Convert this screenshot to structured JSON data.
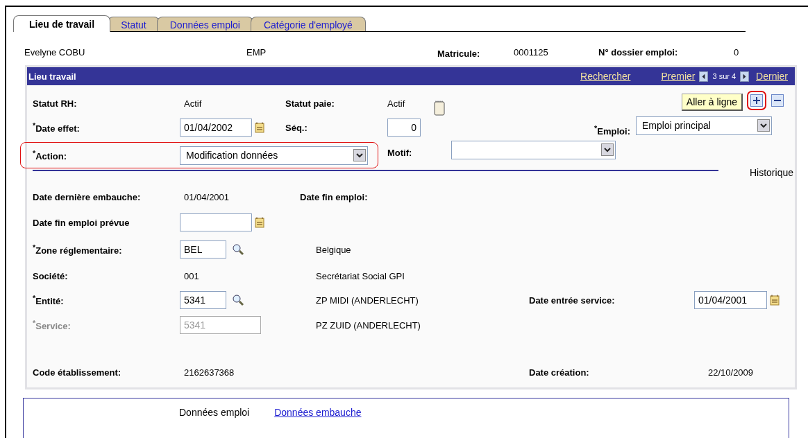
{
  "tabs": [
    {
      "label": "Lieu de travail",
      "selected": true
    },
    {
      "label": "Statut",
      "selected": false
    },
    {
      "label": "Données emploi",
      "selected": false
    },
    {
      "label": "Catégorie d'employé",
      "selected": false
    }
  ],
  "header": {
    "name": "Evelyne COBU",
    "type": "EMP",
    "matricule_label": "Matricule:",
    "matricule": "0001125",
    "dossier_label": "N° dossier emploi:",
    "dossier": "0"
  },
  "panel": {
    "title": "Lieu travail",
    "search_link": "Rechercher",
    "first_link": "Premier",
    "position": "3 sur 4",
    "last_link": "Dernier",
    "tooltip": "Aller à ligne",
    "add_highlighted": true,
    "history_label": "Historique"
  },
  "top": {
    "statut_rh_label": "Statut RH:",
    "statut_rh": "Actif",
    "statut_paie_label": "Statut paie:",
    "statut_paie": "Actif",
    "date_effet_label": "$^{*}$Date effet:",
    "date_effet": "01/04/2002",
    "seq_label": "Séq.:",
    "seq": "0",
    "emploi_label": "$^{*}$Emploi:",
    "emploi": "Emploi principal",
    "action_label": "$^{*}$Action:",
    "action": "Modification données",
    "action_highlighted": true,
    "motif_label": "Motif:"
  },
  "details": {
    "embauche_label": "Date dernière embauche:",
    "embauche": "01/04/2001",
    "fin_label": "Date fin emploi:",
    "fin_prevue_label": "Date fin emploi prévue",
    "zone_label": "$^{*}$Zone réglementaire:",
    "zone": "BEL",
    "zone_desc": "Belgique",
    "societe_label": "Société:",
    "societe": "001",
    "societe_desc": "Secrétariat Social GPI",
    "entite_label": "$^{*}$Entité:",
    "entite": "5341",
    "entite_desc": "ZP MIDI (ANDERLECHT)",
    "entree_label": "Date entrée service:",
    "entree": "01/04/2001",
    "service_label": "$^{*}$Service:",
    "service": "5341",
    "service_disabled": true,
    "service_desc": "PZ ZUID (ANDERLECHT)",
    "code_label": "Code établissement:",
    "code": "2162637368",
    "creation_label": "Date création:",
    "creation": "22/10/2009"
  },
  "footer": {
    "current": "Données emploi",
    "link": "Données embauche"
  }
}
